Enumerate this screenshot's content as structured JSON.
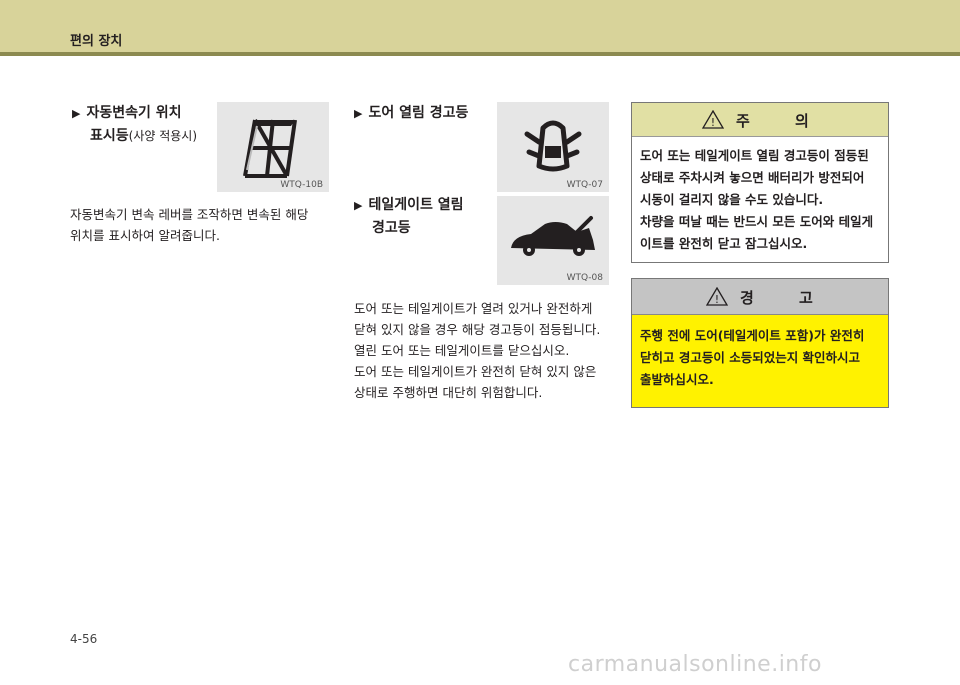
{
  "header": {
    "title": "편의 장치"
  },
  "section1": {
    "arrow": "▶",
    "title_line1": "자동변속기 위치",
    "title_line2": "표시등",
    "title_note": "(사양 적용시)",
    "figure_code": "WTQ-10B",
    "body_lines": [
      "자동변속기 변속 레버를 조작하면 변속된 해당",
      "위치를 표시하여 알려줍니다."
    ]
  },
  "section2": {
    "arrow": "▶",
    "title": "도어 열림 경고등",
    "figure_code": "WTQ-07"
  },
  "section3": {
    "arrow": "▶",
    "title_line1": "테일게이트 열림",
    "title_line2": "경고등",
    "figure_code": "WTQ-08",
    "body_lines": [
      "도어 또는 테일게이트가 열려 있거나 완전하게",
      "닫혀 있지 않을 경우 해당 경고등이 점등됩니다.",
      "열린 도어 또는 테일게이트를 닫으십시오.",
      "도어 또는 테일게이트가 완전히 닫혀 있지 않은",
      "상태로 주행하면 대단히 위험합니다."
    ]
  },
  "caution": {
    "title": "주 의",
    "lines": [
      "도어 또는 테일게이트 열림 경고등이 점등된",
      "상태로 주차시켜 놓으면 배터리가 방전되어",
      "시동이 걸리지 않을 수도 있습니다.",
      "차량을 떠날 때는 반드시 모든 도어와 테일게",
      "이트를 완전히 닫고 잠그십시오."
    ]
  },
  "warning": {
    "title": "경 고",
    "lines": [
      "주행 전에 도어(테일게이트 포함)가 완전히",
      "닫히고 경고등이 소등되었는지 확인하시고",
      "출발하십시오."
    ]
  },
  "page_number": "4-56",
  "watermark": "carmanualsonline.info",
  "colors": {
    "header": "#d8d39a",
    "caution_head": "#e1e0a4",
    "warning_bg": "#fff200",
    "warning_head": "#c4c4c4"
  }
}
